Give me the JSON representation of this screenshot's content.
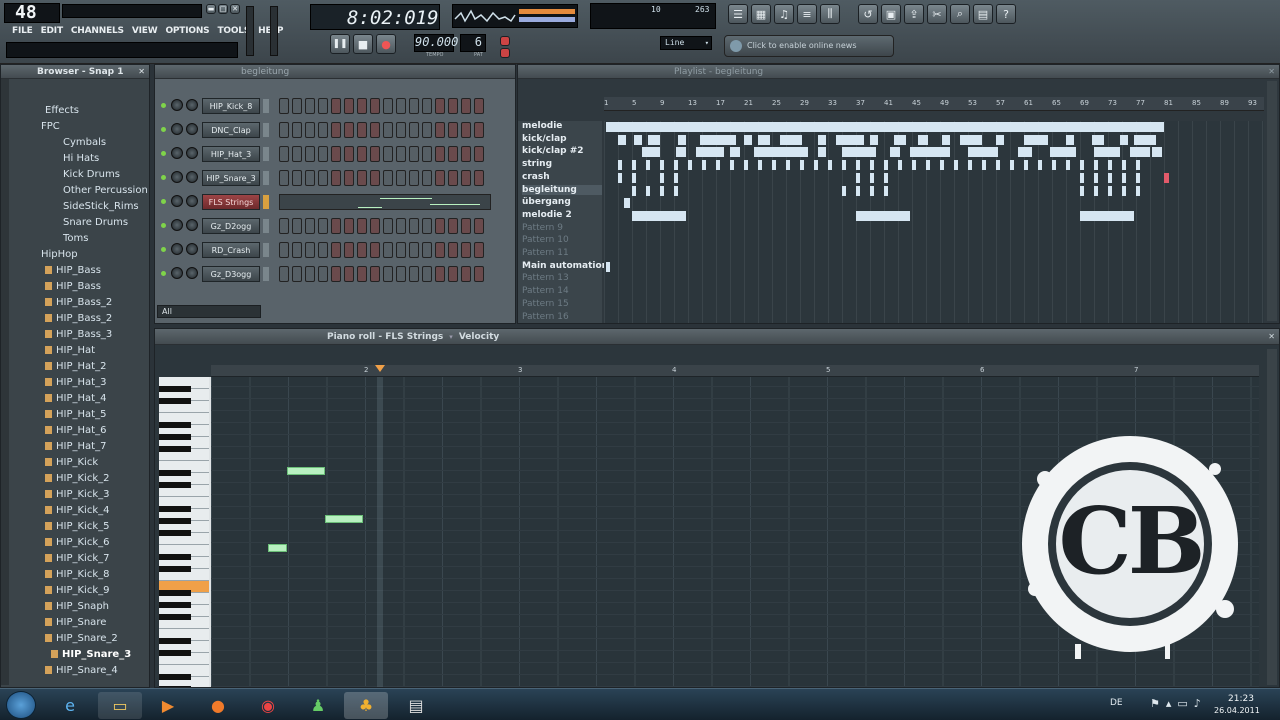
{
  "toolbar": {
    "cpu_display": "48",
    "menu": [
      "FILE",
      "EDIT",
      "CHANNELS",
      "VIEW",
      "OPTIONS",
      "TOOLS",
      "HELP"
    ],
    "time": "8:02:019",
    "tempo": "90.000",
    "tempo_label": "TEMPO",
    "pattern_number": "6",
    "pattern_label": "PAT",
    "snap_mode": "Line",
    "online_news": "Click to enable online news",
    "monitor_left": "10",
    "monitor_right": "263"
  },
  "browser": {
    "title": "Browser - Snap 1",
    "items": [
      {
        "label": "Effects",
        "type": "folder"
      },
      {
        "label": "FPC",
        "type": "folder"
      },
      {
        "label": "Cymbals",
        "type": "folder"
      },
      {
        "label": "Hi Hats",
        "type": "folder"
      },
      {
        "label": "Kick Drums",
        "type": "folder"
      },
      {
        "label": "Other Percussion",
        "type": "folder"
      },
      {
        "label": "SideStick_Rims",
        "type": "folder"
      },
      {
        "label": "Snare Drums",
        "type": "folder"
      },
      {
        "label": "Toms",
        "type": "folder"
      },
      {
        "label": "HipHop",
        "type": "folder"
      },
      {
        "label": "HIP_Bass",
        "type": "sample"
      },
      {
        "label": "HIP_Bass",
        "type": "sample"
      },
      {
        "label": "HIP_Bass_2",
        "type": "sample"
      },
      {
        "label": "HIP_Bass_2",
        "type": "sample"
      },
      {
        "label": "HIP_Bass_3",
        "type": "sample"
      },
      {
        "label": "HIP_Hat",
        "type": "sample"
      },
      {
        "label": "HIP_Hat_2",
        "type": "sample"
      },
      {
        "label": "HIP_Hat_3",
        "type": "sample"
      },
      {
        "label": "HIP_Hat_4",
        "type": "sample"
      },
      {
        "label": "HIP_Hat_5",
        "type": "sample"
      },
      {
        "label": "HIP_Hat_6",
        "type": "sample"
      },
      {
        "label": "HIP_Hat_7",
        "type": "sample"
      },
      {
        "label": "HIP_Kick",
        "type": "sample"
      },
      {
        "label": "HIP_Kick_2",
        "type": "sample"
      },
      {
        "label": "HIP_Kick_3",
        "type": "sample"
      },
      {
        "label": "HIP_Kick_4",
        "type": "sample"
      },
      {
        "label": "HIP_Kick_5",
        "type": "sample"
      },
      {
        "label": "HIP_Kick_6",
        "type": "sample"
      },
      {
        "label": "HIP_Kick_7",
        "type": "sample"
      },
      {
        "label": "HIP_Kick_8",
        "type": "sample"
      },
      {
        "label": "HIP_Kick_9",
        "type": "sample"
      },
      {
        "label": "HIP_Snaph",
        "type": "sample"
      },
      {
        "label": "HIP_Snare",
        "type": "sample"
      },
      {
        "label": "HIP_Snare_2",
        "type": "sample"
      },
      {
        "label": "HIP_Snare_3",
        "type": "sample"
      },
      {
        "label": "HIP_Snare_4",
        "type": "sample"
      }
    ]
  },
  "step_seq": {
    "pattern": "begleitung",
    "filter": "All",
    "channels": [
      {
        "name": "HIP_Kick_8",
        "selected": false
      },
      {
        "name": "DNC_Clap",
        "selected": false
      },
      {
        "name": "HIP_Hat_3",
        "selected": false
      },
      {
        "name": "HIP_Snare_3",
        "selected": false
      },
      {
        "name": "FLS Strings",
        "selected": true
      },
      {
        "name": "Gz_D2ogg",
        "selected": false
      },
      {
        "name": "RD_Crash",
        "selected": false
      },
      {
        "name": "Gz_D3ogg",
        "selected": false
      }
    ]
  },
  "playlist": {
    "title": "Playlist - begleitung",
    "ruler": [
      "1",
      "5",
      "9",
      "13",
      "17",
      "21",
      "25",
      "29",
      "33",
      "37",
      "41",
      "45",
      "49",
      "53",
      "57",
      "61",
      "65",
      "69",
      "73",
      "77",
      "81",
      "85",
      "89",
      "93"
    ],
    "tracks": [
      {
        "name": "melodie",
        "dim": false
      },
      {
        "name": "kick/clap",
        "dim": false
      },
      {
        "name": "kick/clap #2",
        "dim": false
      },
      {
        "name": "string",
        "dim": false
      },
      {
        "name": "crash",
        "dim": false
      },
      {
        "name": "begleitung",
        "dim": false
      },
      {
        "name": "übergang",
        "dim": false
      },
      {
        "name": "melodie 2",
        "dim": false
      },
      {
        "name": "Pattern 9",
        "dim": true
      },
      {
        "name": "Pattern 10",
        "dim": true
      },
      {
        "name": "Pattern 11",
        "dim": true
      },
      {
        "name": "Main automation",
        "dim": false
      },
      {
        "name": "Pattern 13",
        "dim": true
      },
      {
        "name": "Pattern 14",
        "dim": true
      },
      {
        "name": "Pattern 15",
        "dim": true
      },
      {
        "name": "Pattern 16",
        "dim": true
      }
    ]
  },
  "piano_roll": {
    "title": "Piano roll - FLS Strings",
    "mode": "Velocity",
    "ruler": [
      "2",
      "3",
      "4",
      "5",
      "6",
      "7"
    ]
  },
  "logo_text": "CB",
  "taskbar": {
    "lang": "DE",
    "time": "21:23",
    "date": "26.04.2011"
  },
  "colors": {
    "accent_green": "#b8f0c0",
    "playlist_block": "#d6e6f2",
    "selected_channel": "#9d4446"
  }
}
